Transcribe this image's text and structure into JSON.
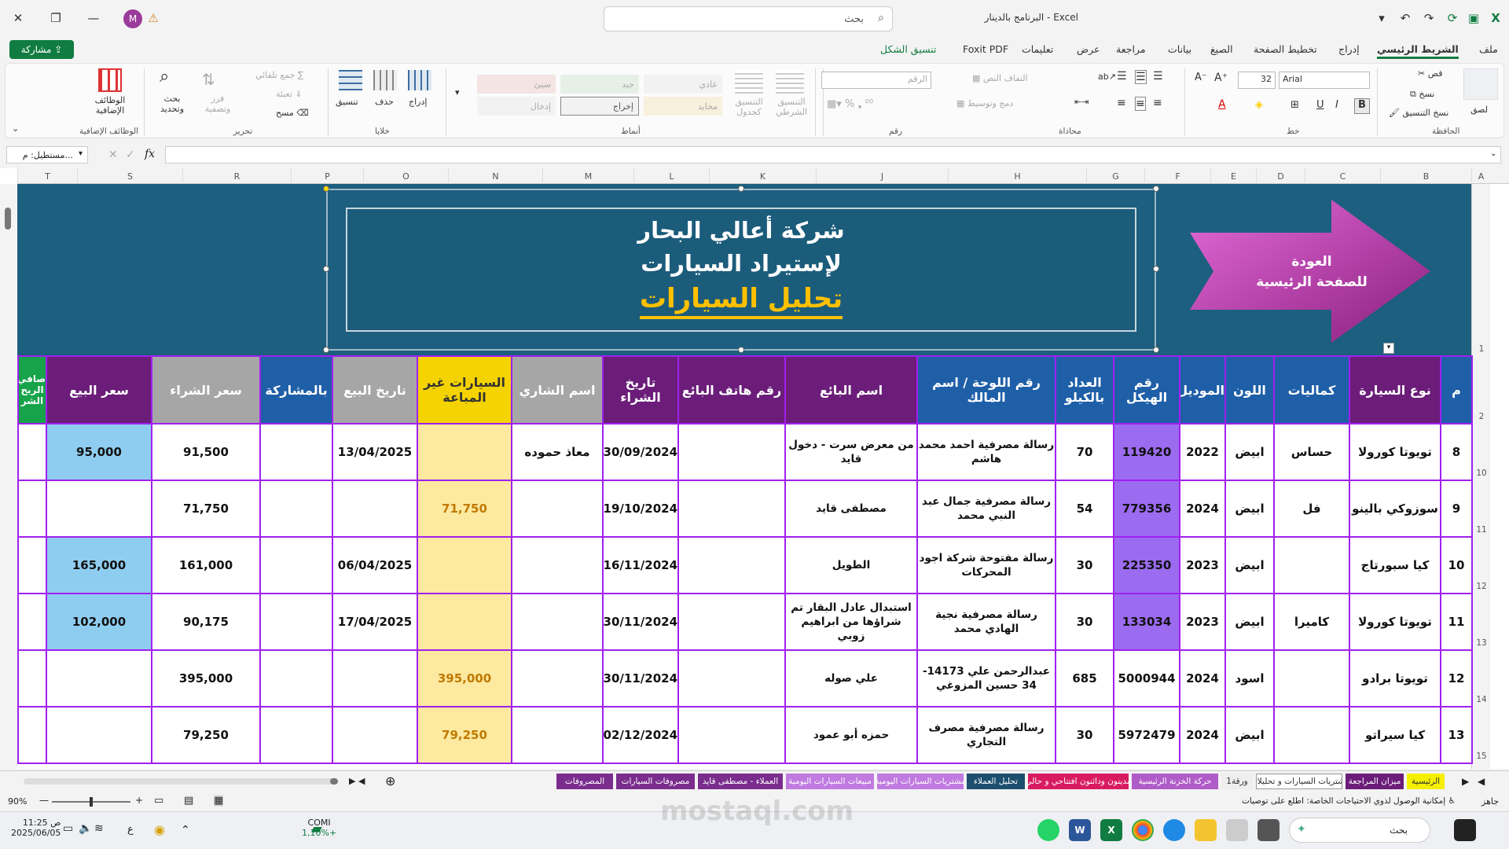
{
  "window": {
    "app": "Excel",
    "document_title": "البرنامج بالدينار",
    "search_placeholder": "بحث",
    "avatar_letter": "M"
  },
  "menu": {
    "items": [
      "ملف",
      "الشريط الرئيسي",
      "إدراج",
      "تخطيط الصفحة",
      "الصيغ",
      "بيانات",
      "مراجعة",
      "عرض",
      "تعليمات",
      "Foxit PDF",
      "تنسيق الشكل"
    ],
    "share_label": "مشاركة"
  },
  "ribbon": {
    "clipboard": {
      "label": "الحافظة",
      "paste": "لصق",
      "cut": "قص",
      "copy": "نسخ",
      "format_painter": "نسخ التنسيق"
    },
    "font": {
      "label": "خط",
      "name": "Arial",
      "size": "32"
    },
    "alignment": {
      "label": "محاذاة",
      "wrap": "التفاف النص",
      "merge": "دمج وتوسيط"
    },
    "number": {
      "label": "رقم",
      "format": "الرقم"
    },
    "styles": {
      "label": "أنماط",
      "conditional": "التنسيق الشرطي",
      "as_table": "التنسيق كجدول",
      "cells": [
        "عادي",
        "جيد",
        "سيئ",
        "محايد",
        "إخراج",
        "إدخال"
      ]
    },
    "cells": {
      "label": "خلايا",
      "insert": "إدراج",
      "delete": "حذف",
      "format": "تنسيق"
    },
    "editing": {
      "label": "تحرير",
      "autosum": "جمع تلقائي",
      "fill": "تعبئة",
      "clear": "مسح",
      "sort": "فرز وتصفية",
      "find": "بحث وتحديد"
    },
    "addins": {
      "label": "الوظائف الإضافية",
      "button": "الوظائف الإضافية"
    }
  },
  "formula_bar": {
    "name_box": "مستطيل: م...",
    "fx": "fx",
    "value": ""
  },
  "columns": [
    "A",
    "B",
    "C",
    "D",
    "E",
    "F",
    "G",
    "H",
    "J",
    "K",
    "L",
    "M",
    "N",
    "O",
    "P",
    "R",
    "S",
    "T"
  ],
  "banner": {
    "line1": "شركة أعالي البحار",
    "line2": "لإستيراد السيارات",
    "line3": "تحليل السيارات",
    "back_button": "العودة\nللصفحة الرئيسية",
    "back_line1": "العودة",
    "back_line2": "للصفحة الرئيسية"
  },
  "row_numbers": [
    "1",
    "2",
    "10",
    "11",
    "12",
    "13",
    "14",
    "15"
  ],
  "table": {
    "headers": [
      "م",
      "نوع السيارة",
      "كماليات",
      "اللون",
      "الموديل",
      "رقم الهيكل",
      "العداد بالكيلو",
      "رقم اللوحة / اسم المالك",
      "اسم البائع",
      "رقم هاتف البائع",
      "تاريخ الشراء",
      "اسم الشاري",
      "السيارات غير المباعة",
      "تاريخ البيع",
      "بالمشاركة",
      "سعر الشراء",
      "سعر البيع",
      "صافي الربح الشر"
    ],
    "rows": [
      [
        "8",
        "تويوتا كورولا",
        "حساس",
        "ابيض",
        "2022",
        "119420",
        "70",
        "رسالة مصرفية احمد محمد هاشم",
        "من معرض سرت - دخول قايد",
        "",
        "30/09/2024",
        "معاذ حموده",
        "",
        "13/04/2025",
        "",
        "91,500",
        "95,000",
        ""
      ],
      [
        "9",
        "سوزوكي بالينو",
        "فل",
        "ابيض",
        "2024",
        "779356",
        "54",
        "رسالة مصرفية جمال عبد النبي محمد",
        "مصطفى قايد",
        "",
        "19/10/2024",
        "",
        "71,750",
        "",
        "",
        "71,750",
        "",
        ""
      ],
      [
        "10",
        "كيا سبورتاج",
        "",
        "ابيض",
        "2023",
        "225350",
        "30",
        "رسالة مفتوحة شركة اجود المحركات",
        "الطويل",
        "",
        "16/11/2024",
        "",
        "",
        "06/04/2025",
        "",
        "161,000",
        "165,000",
        ""
      ],
      [
        "11",
        "تويوتا كورولا",
        "كاميرا",
        "ابيض",
        "2023",
        "133034",
        "30",
        "رسالة مصرفية نجية الهادي محمد",
        "استبدال عادل البقار تم شراؤها من ابراهيم زوبي",
        "",
        "30/11/2024",
        "",
        "",
        "17/04/2025",
        "",
        "90,175",
        "102,000",
        ""
      ],
      [
        "12",
        "تويوتا برادو",
        "",
        "اسود",
        "2024",
        "5000944",
        "685",
        "عبدالرحمن علي 14173-34 حسين المزوغي",
        "علي صوله",
        "",
        "30/11/2024",
        "",
        "395,000",
        "",
        "",
        "395,000",
        "",
        ""
      ],
      [
        "13",
        "كيا سيراتو",
        "",
        "ابيض",
        "2024",
        "5972479",
        "30",
        "رسالة مصرفية مصرف التجاري",
        "حمزه أبو عمود",
        "",
        "02/12/2024",
        "",
        "79,250",
        "",
        "",
        "79,250",
        "",
        ""
      ]
    ]
  },
  "sheet_tabs": [
    {
      "label": "الرئيسية",
      "color": "#f5f000",
      "text": "#333"
    },
    {
      "label": "ميزان المراجعة",
      "color": "#6b1d79",
      "text": "#fff"
    },
    {
      "label": "مشتريات السيارات و تحليلاتها",
      "color": "#fff",
      "text": "#333"
    },
    {
      "label": "ورقة1",
      "color": "#eee",
      "text": "#333"
    },
    {
      "label": "حركة الخزنة الرئيسية",
      "color": "#b05cc8",
      "text": "#fff"
    },
    {
      "label": "مدينون ودائنون افتتاحي و حالي",
      "color": "#d81b60",
      "text": "#fff"
    },
    {
      "label": "تحليل العملاء",
      "color": "#1c4f6e",
      "text": "#fff"
    },
    {
      "label": "مشتريات السيارات اليومية",
      "color": "#c07ae0",
      "text": "#fff"
    },
    {
      "label": "مبيعات السيارات اليومية",
      "color": "#c07ae0",
      "text": "#fff"
    },
    {
      "label": "العملاء - مصطفى قايد",
      "color": "#7b2d8e",
      "text": "#fff"
    },
    {
      "label": "مصروفات السيارات",
      "color": "#7b2d8e",
      "text": "#fff"
    },
    {
      "label": "المصروفات",
      "color": "#7b2d8e",
      "text": "#fff"
    }
  ],
  "status": {
    "ready": "جاهز",
    "accessibility": "إمكانية الوصول لذوي الاحتياجات الخاصة: اطلع على توصيات",
    "zoom": "90%"
  },
  "taskbar": {
    "search": "بحث",
    "time": "11:25 ص",
    "date": "2025/06/05",
    "lang": "ع",
    "ticker": "COMI",
    "ticker_value": "1,10%+"
  },
  "watermark": "mostaql.com"
}
